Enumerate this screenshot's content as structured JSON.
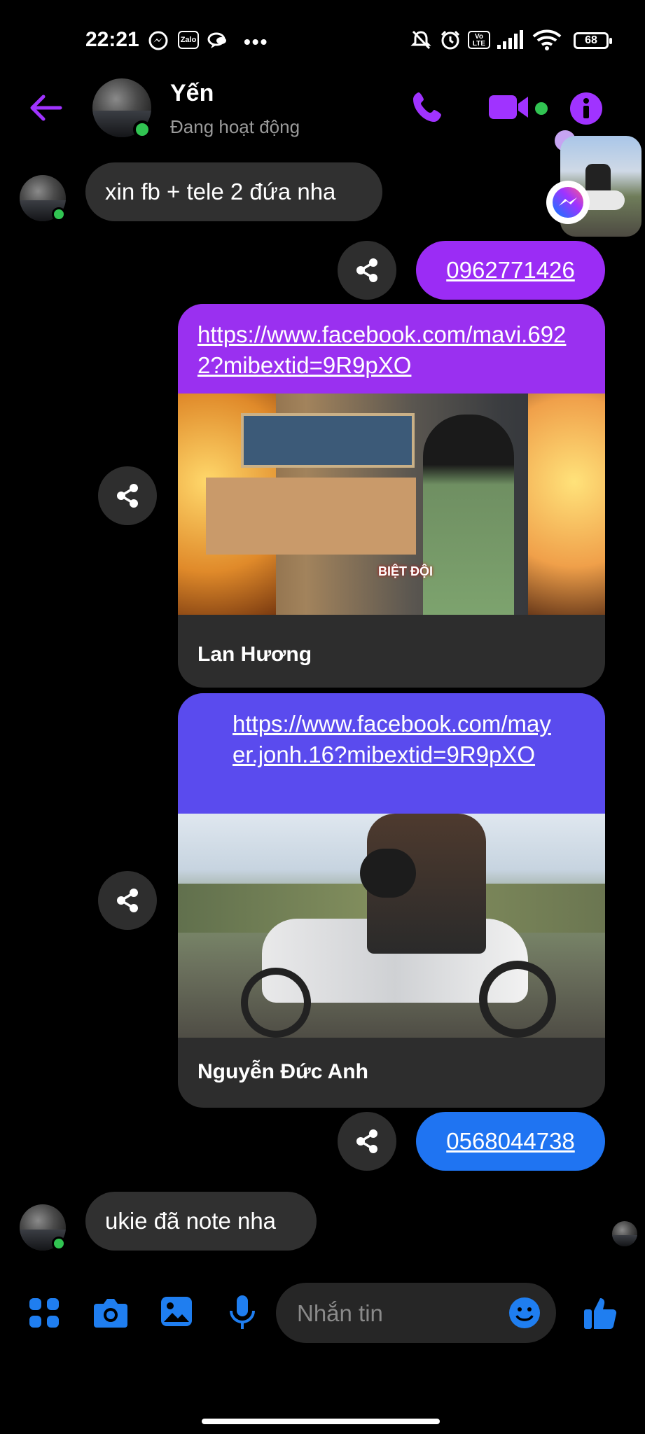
{
  "status_bar": {
    "time": "22:21",
    "notification_icons": [
      "messenger-icon",
      "zalo-icon",
      "chat-bubble-icon",
      "more-dots-icon"
    ],
    "zalo_text": "Zalo",
    "right_icons": [
      "muted-bell-icon",
      "alarm-icon",
      "volte-icon",
      "signal-icon",
      "wifi-icon"
    ],
    "volte_text": "Vo LTE",
    "battery": "68"
  },
  "header": {
    "contact_name": "Yến",
    "contact_status": "Đang hoạt động",
    "accent_color": "#a033ff"
  },
  "messages": [
    {
      "id": "m1",
      "from": "them",
      "text": "xin fb + tele 2 đứa nha"
    },
    {
      "id": "m2",
      "from": "me",
      "text": "0962771426",
      "color": "#9b2cf5"
    },
    {
      "id": "m3",
      "from": "me",
      "type": "link",
      "url": "https://www.facebook.com/mavi.6922?mibextid=9R9pXO",
      "card_title": "Lan Hương",
      "color": "#9a30f0"
    },
    {
      "id": "m4",
      "from": "me",
      "type": "link",
      "url": "https://www.facebook.com/mayer.jonh.16?mibextid=9R9pXO",
      "card_title": "Nguyễn Đức Anh",
      "color": "#5a4bee"
    },
    {
      "id": "m5",
      "from": "me",
      "text": "0568044738",
      "color": "#1f74f2"
    },
    {
      "id": "m6",
      "from": "them",
      "text": "ukie đã note nha"
    }
  ],
  "link_preview_1": {
    "banner_text": "BIỆT ĐỘI"
  },
  "composer": {
    "placeholder": "Nhắn tin",
    "icon_color": "#1f7ef0"
  }
}
